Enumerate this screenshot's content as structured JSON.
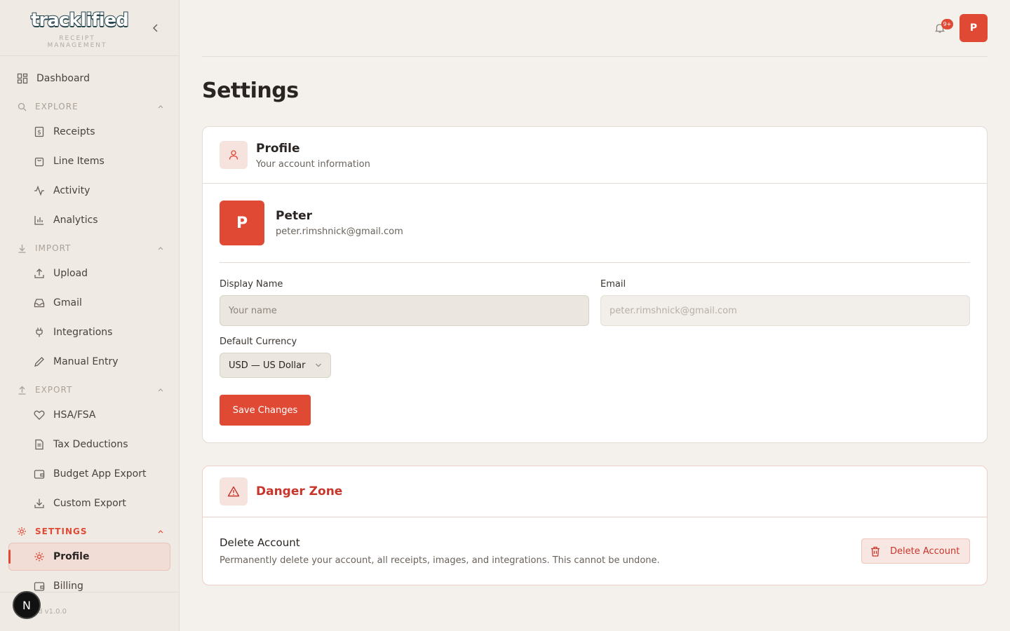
{
  "brand": {
    "logo_text": "tracklified",
    "subtitle": "RECEIPT MANAGEMENT"
  },
  "sidebar": {
    "dashboard": "Dashboard",
    "explore": {
      "label": "EXPLORE",
      "items": [
        "Receipts",
        "Line Items",
        "Activity",
        "Analytics"
      ]
    },
    "import": {
      "label": "IMPORT",
      "items": [
        "Upload",
        "Gmail",
        "Integrations",
        "Manual Entry"
      ]
    },
    "export": {
      "label": "EXPORT",
      "items": [
        "HSA/FSA",
        "Tax Deductions",
        "Budget App Export",
        "Custom Export"
      ]
    },
    "settings": {
      "label": "SETTINGS",
      "items": [
        "Profile",
        "Billing"
      ]
    },
    "version": "ed v1.0.0",
    "dev_badge": "N"
  },
  "header": {
    "notification_count": "9+",
    "avatar_initial": "P"
  },
  "page": {
    "title": "Settings"
  },
  "profile_card": {
    "title": "Profile",
    "subtitle": "Your account information",
    "avatar_initial": "P",
    "name": "Peter",
    "email": "peter.rimshnick@gmail.com",
    "display_name_label": "Display Name",
    "display_name_placeholder": "Your name",
    "email_label": "Email",
    "email_placeholder": "peter.rimshnick@gmail.com",
    "currency_label": "Default Currency",
    "currency_value": "USD — US Dollar",
    "save_label": "Save Changes"
  },
  "danger_zone": {
    "title": "Danger Zone",
    "delete_title": "Delete Account",
    "delete_desc": "Permanently delete your account, all receipts, images, and integrations. This cannot be undone.",
    "delete_button": "Delete Account"
  },
  "colors": {
    "accent": "#e04a35",
    "danger_text": "#c8352b",
    "background": "#f4f0eb",
    "sidebar": "#efeae4"
  }
}
